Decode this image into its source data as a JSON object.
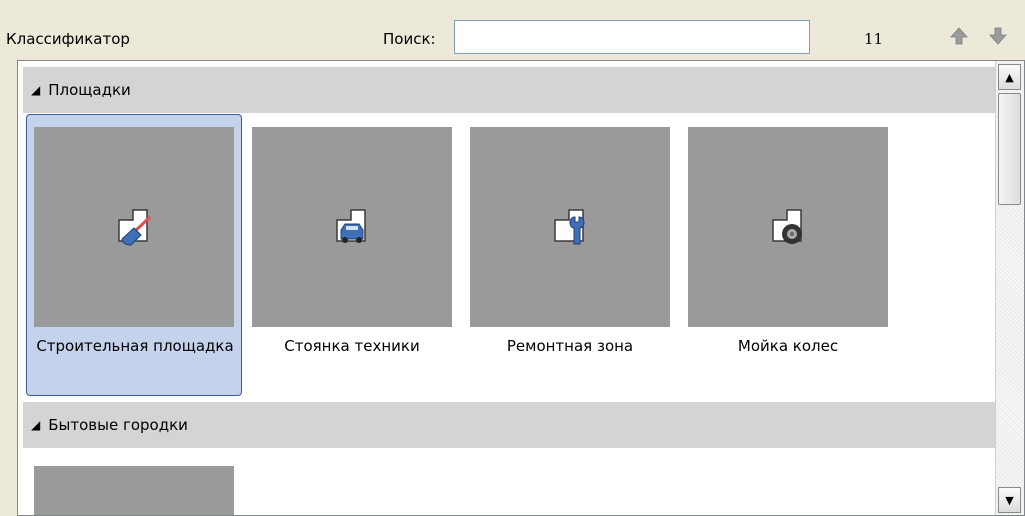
{
  "toolbar": {
    "title": "Классификатор",
    "search_label": "Поиск:",
    "search_value": "",
    "count": "11",
    "prev_icon": "arrow-up-icon",
    "next_icon": "arrow-down-icon"
  },
  "groups": [
    {
      "label": "Площадки",
      "items": [
        {
          "label": "Строительная площадка",
          "icon": "construction-site-icon",
          "selected": true
        },
        {
          "label": "Стоянка техники",
          "icon": "vehicle-parking-icon",
          "selected": false
        },
        {
          "label": "Ремонтная зона",
          "icon": "repair-zone-icon",
          "selected": false
        },
        {
          "label": "Мойка колес",
          "icon": "wheel-wash-icon",
          "selected": false
        }
      ]
    },
    {
      "label": "Бытовые городки",
      "items": []
    }
  ],
  "colors": {
    "tile_bg": "#9a9a9a",
    "selection_bg": "#c4d2ec",
    "selection_border": "#3c5b9a",
    "group_header_bg": "#d4d4d4",
    "icon_blue": "#3f6fb5"
  }
}
